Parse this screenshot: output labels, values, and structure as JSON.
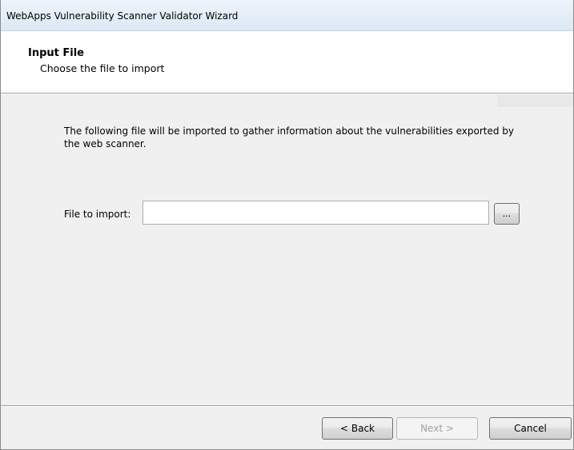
{
  "window": {
    "title": "WebApps Vulnerability Scanner Validator Wizard"
  },
  "header": {
    "title": "Input File",
    "subtitle": "Choose the file to import"
  },
  "main": {
    "description": "The following file will be imported to gather information about the vulnerabilities exported by the web scanner.",
    "file_label": "File to import:",
    "file_value": "",
    "browse_label": "..."
  },
  "footer": {
    "back_label": "< Back",
    "next_label": "Next >",
    "next_enabled": false,
    "cancel_label": "Cancel"
  }
}
